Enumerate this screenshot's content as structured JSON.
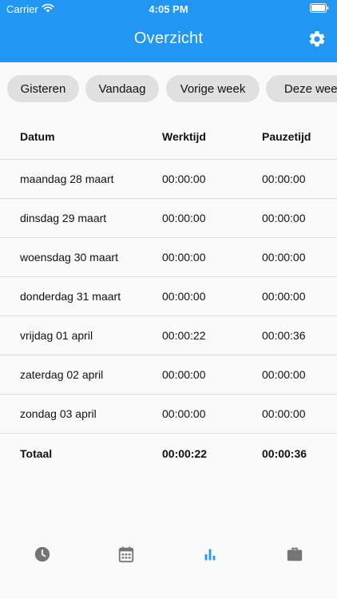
{
  "status_bar": {
    "carrier": "Carrier",
    "time": "4:05 PM"
  },
  "app_bar": {
    "title": "Overzicht",
    "settings_icon": "gear-icon"
  },
  "chips": [
    {
      "label": "Gisteren",
      "selected": false
    },
    {
      "label": "Vandaag",
      "selected": false
    },
    {
      "label": "Vorige week",
      "selected": false
    },
    {
      "label": "Deze week",
      "selected": true
    }
  ],
  "table": {
    "headers": {
      "date": "Datum",
      "work": "Werktijd",
      "break": "Pauzetijd"
    },
    "rows": [
      {
        "date": "maandag 28 maart",
        "work": "00:00:00",
        "break": "00:00:00"
      },
      {
        "date": "dinsdag 29 maart",
        "work": "00:00:00",
        "break": "00:00:00"
      },
      {
        "date": "woensdag 30 maart",
        "work": "00:00:00",
        "break": "00:00:00"
      },
      {
        "date": "donderdag 31 maart",
        "work": "00:00:00",
        "break": "00:00:00"
      },
      {
        "date": "vrijdag 01 april",
        "work": "00:00:22",
        "break": "00:00:36"
      },
      {
        "date": "zaterdag 02 april",
        "work": "00:00:00",
        "break": "00:00:00"
      },
      {
        "date": "zondag 03 april",
        "work": "00:00:00",
        "break": "00:00:00"
      }
    ],
    "total": {
      "label": "Totaal",
      "work": "00:00:22",
      "break": "00:00:36"
    }
  },
  "bottom_nav": {
    "active_index": 2,
    "items": [
      {
        "icon": "clock-icon"
      },
      {
        "icon": "calendar-icon"
      },
      {
        "icon": "bar-chart-icon"
      },
      {
        "icon": "briefcase-icon"
      }
    ]
  },
  "colors": {
    "primary": "#2196f3",
    "chip_inactive": "#e0e0e0",
    "nav_inactive": "#757575",
    "divider": "#dcdcdc",
    "background": "#fafafa"
  }
}
